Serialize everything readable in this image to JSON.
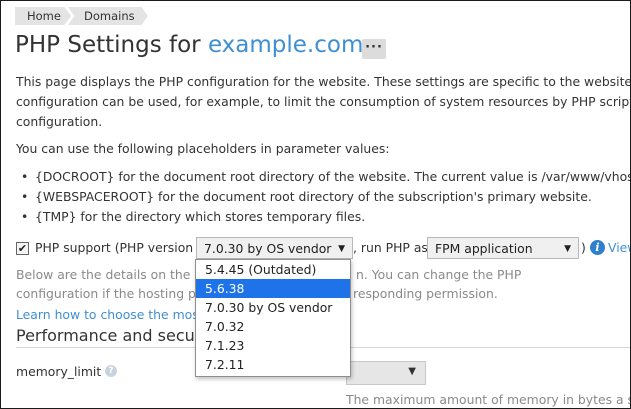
{
  "breadcrumb": {
    "home": "Home",
    "domains": "Domains"
  },
  "title": {
    "prefix": "PHP Settings for ",
    "domain": "example.com",
    "more": "···"
  },
  "intro": {
    "line1": "This page displays the PHP configuration for the website. These settings are specific to the website an",
    "line2": "configuration can be used, for example, to limit the consumption of system resources by PHP scripts,",
    "line3": "configuration."
  },
  "placeholders": {
    "intro": "You can use the following placeholders in parameter values:",
    "items": [
      "{DOCROOT} for the document root directory of the website. The current value is /var/www/vhosts/",
      "{WEBSPACEROOT} for the document root directory of the subscription's primary website.",
      "{TMP} for the directory which stores temporary files."
    ]
  },
  "php_support": {
    "checked": true,
    "check_glyph": "✔",
    "label": "PHP support (PHP version",
    "version_selected": "7.0.30 by OS vendor",
    "run_as_label": ", run PHP as",
    "handler_selected": "FPM application",
    "close_paren": ")",
    "view_link": "View",
    "info_icon": "i"
  },
  "below": {
    "line1a": "Below are the details on the w",
    "line1b": "n. You can change the PHP",
    "line2a": "configuration if the hosting pr",
    "line2b": "responding permission."
  },
  "learn_link": "Learn how to choose the mos",
  "section_title": "Performance and securi",
  "memory_limit": {
    "label": "memory_limit",
    "help": "?",
    "hint": "The maximum amount of memory in bytes a script is allowed to al"
  },
  "version_dropdown": {
    "options": [
      "5.4.45 (Outdated)",
      "5.6.38",
      "7.0.30 by OS vendor",
      "7.0.32",
      "7.1.23",
      "7.2.11"
    ],
    "highlighted_index": 1,
    "highlight_color": "#1e73e8"
  },
  "colors": {
    "link": "#3f8fd2",
    "accent": "#2f7fcc"
  },
  "icons": {
    "dropdown_arrow": "▼"
  }
}
